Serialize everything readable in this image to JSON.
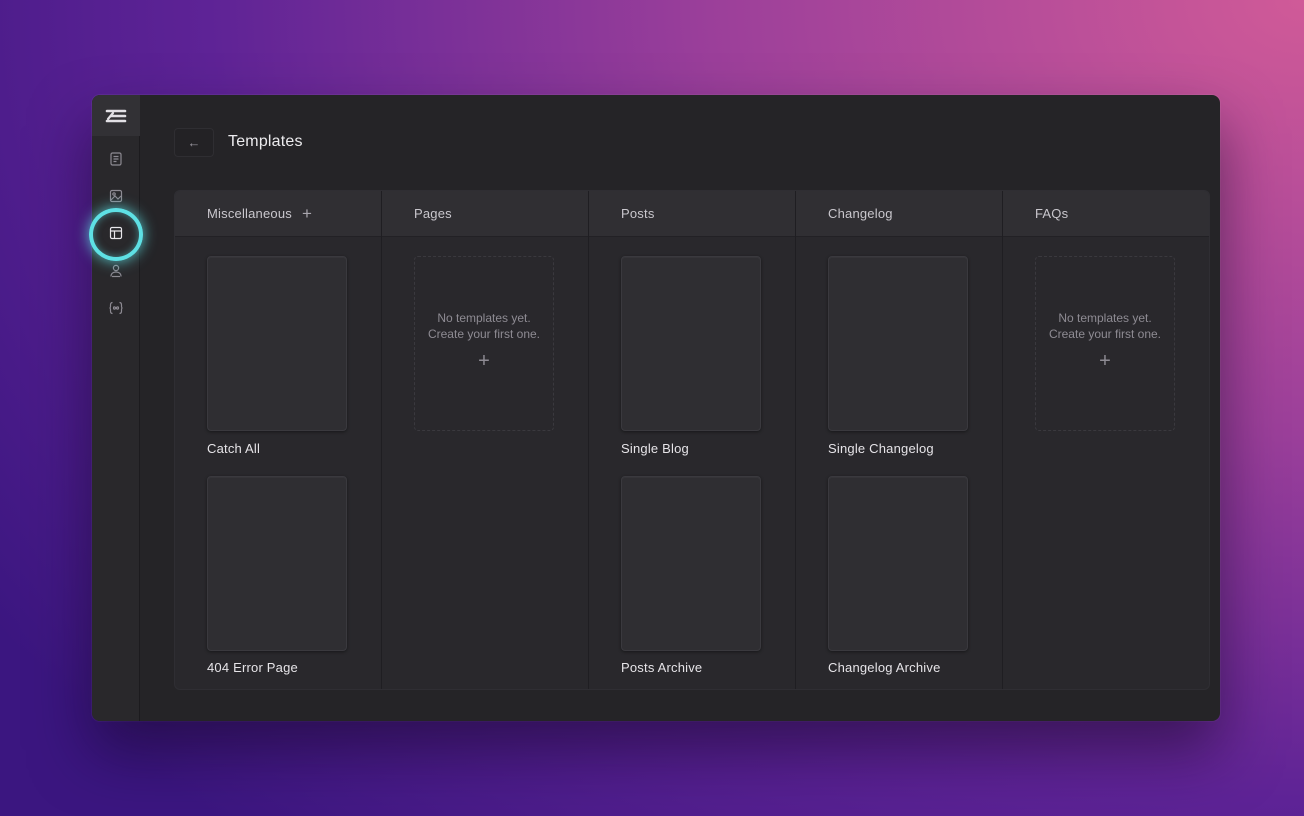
{
  "window": {
    "title": "Templates",
    "back_icon": "arrow-left-icon",
    "back_glyph": "←"
  },
  "sidebar": {
    "logo": "stacked-lines-logo",
    "items": [
      {
        "name": "pages-icon",
        "active": false
      },
      {
        "name": "media-icon",
        "active": false
      },
      {
        "name": "templates-icon",
        "active": true
      },
      {
        "name": "users-icon",
        "active": false
      },
      {
        "name": "variables-icon",
        "active": false
      }
    ]
  },
  "columns": [
    {
      "title": "Miscellaneous",
      "add_glyph": "+",
      "templates": [
        {
          "label": "Catch All"
        },
        {
          "label": "404 Error Page"
        }
      ]
    },
    {
      "title": "Pages",
      "empty_line1": "No templates yet.",
      "empty_line2": "Create your first one.",
      "empty_add_glyph": "+"
    },
    {
      "title": "Posts",
      "templates": [
        {
          "label": "Single Blog"
        },
        {
          "label": "Posts Archive"
        }
      ]
    },
    {
      "title": "Changelog",
      "templates": [
        {
          "label": "Single Changelog"
        },
        {
          "label": "Changelog Archive"
        }
      ]
    },
    {
      "title": "FAQs",
      "empty_line1": "No templates yet.",
      "empty_line2": "Create your first one.",
      "empty_add_glyph": "+"
    }
  ],
  "colors": {
    "highlight": "#5ee0e4",
    "window_bg": "#252427"
  }
}
